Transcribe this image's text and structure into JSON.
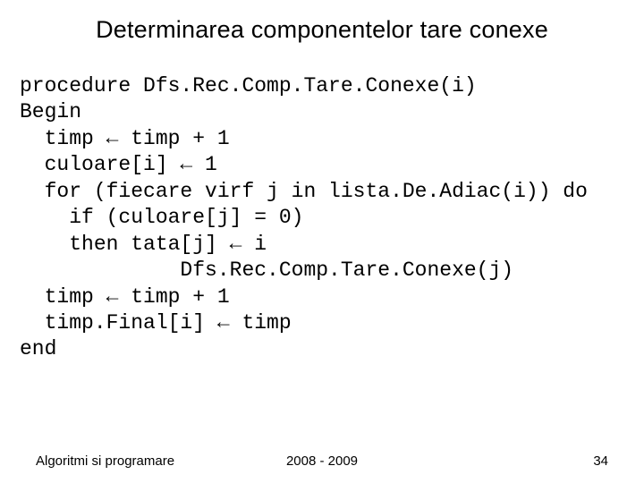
{
  "title": "Determinarea componentelor tare conexe",
  "code": {
    "l1": "procedure Dfs.Rec.Comp.Tare.Conexe(i)",
    "l2": "Begin",
    "l3": "  timp ← timp + 1",
    "l4": "  culoare[i] ← 1",
    "l5": "  for (fiecare virf j in lista.De.Adiac(i)) do",
    "l6": "    if (culoare[j] = 0)",
    "l7": "    then tata[j] ← i",
    "l8": "             Dfs.Rec.Comp.Tare.Conexe(j)",
    "l9": "  timp ← timp + 1",
    "l10": "  timp.Final[i] ← timp",
    "l11": "end"
  },
  "footer": {
    "left": "Algoritmi si programare",
    "center": "2008 - 2009",
    "right": "34"
  }
}
